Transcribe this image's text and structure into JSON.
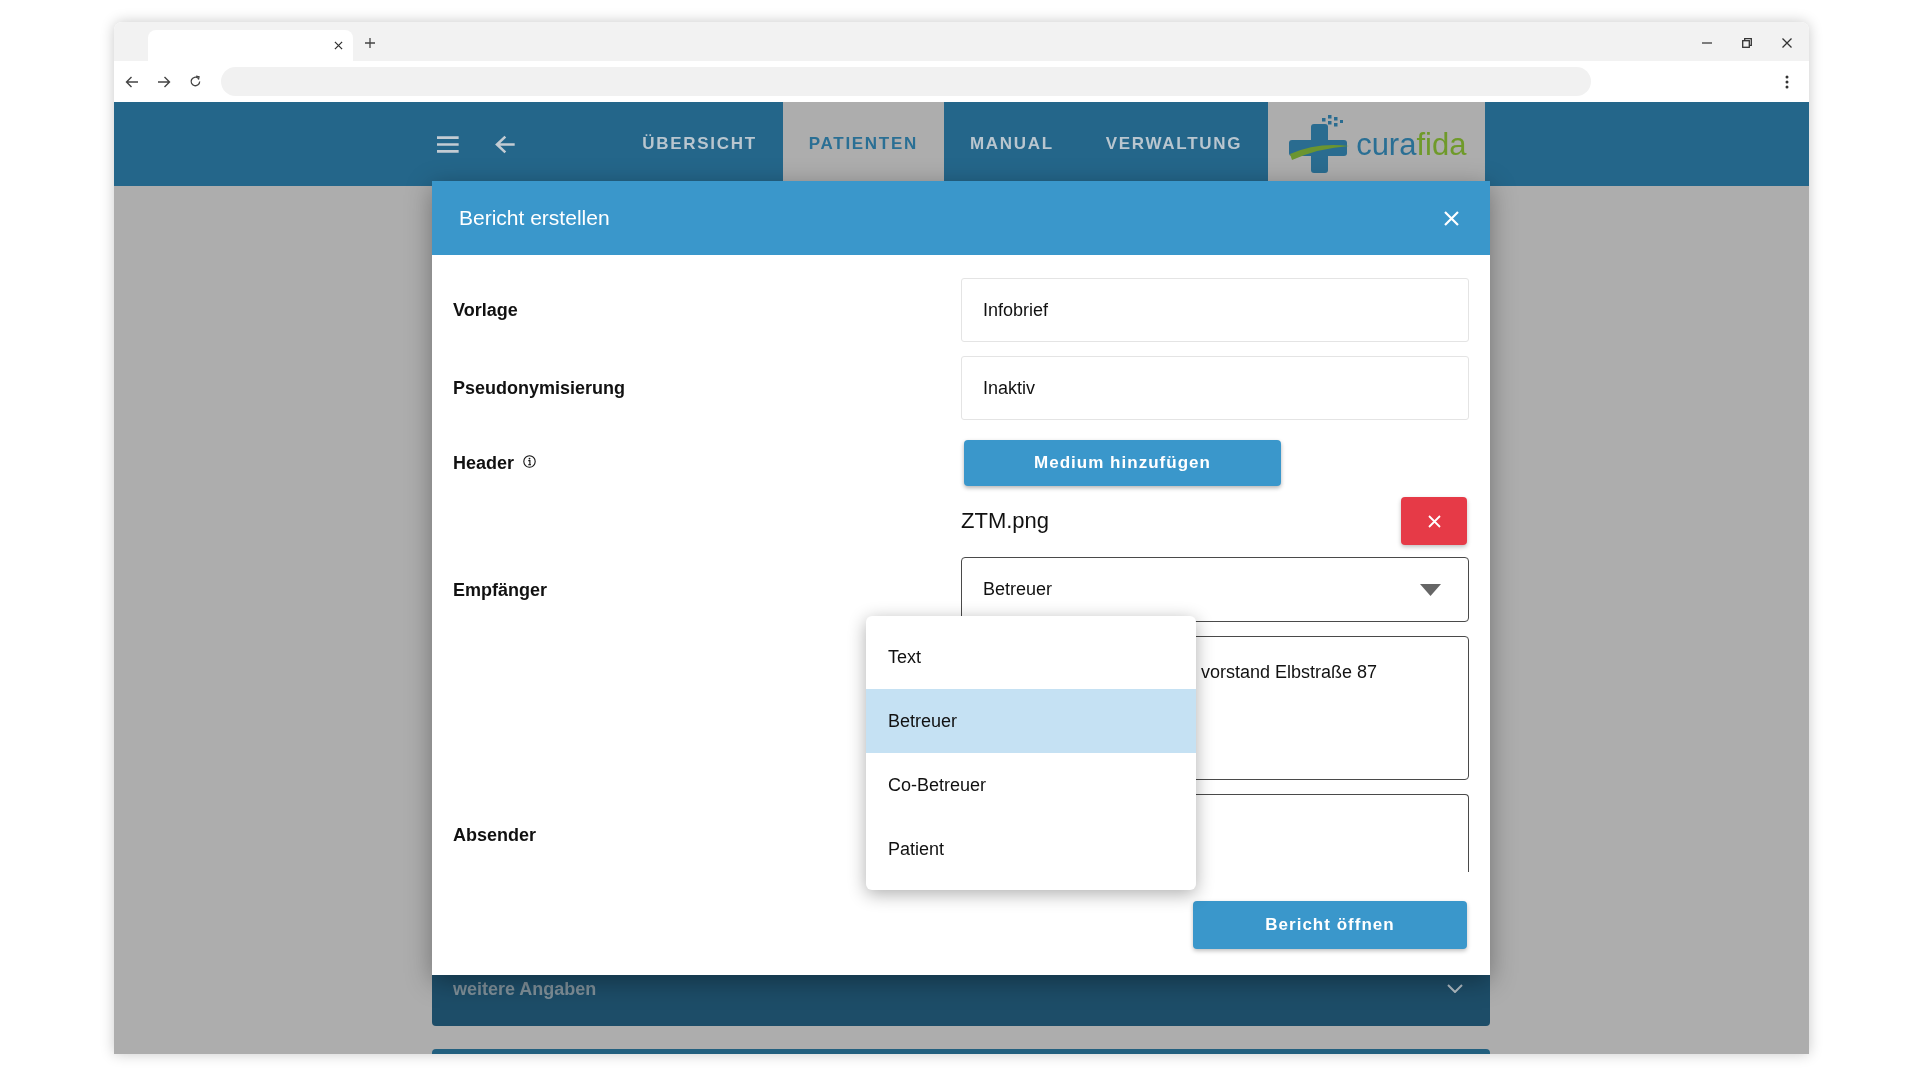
{
  "app_header": {
    "nav": [
      {
        "label": "ÜBERSICHT",
        "selected": false
      },
      {
        "label": "PATIENTEN",
        "selected": true
      },
      {
        "label": "MANUAL",
        "selected": false
      },
      {
        "label": "VERWALTUNG",
        "selected": false
      }
    ],
    "logo": {
      "wordmark_parts": [
        "cura",
        "fida"
      ]
    }
  },
  "dialog": {
    "title": "Bericht erstellen",
    "rows": [
      {
        "kind": "input",
        "label": "Vorlage",
        "value": "Infobrief"
      },
      {
        "kind": "input",
        "label": "Pseudonymisierung",
        "value": "Inaktiv"
      },
      {
        "kind": "media",
        "label": "Header",
        "info": true,
        "button": "Medium hinzufügen"
      },
      {
        "kind": "file",
        "file": "ZTM.png"
      },
      {
        "kind": "select",
        "label": "Empfänger",
        "value": "Betreuer",
        "expanded": true,
        "options": [
          {
            "label": "Text",
            "selected": false
          },
          {
            "label": "Betreuer",
            "selected": true
          },
          {
            "label": "Co-Betreuer",
            "selected": false
          },
          {
            "label": "Patient",
            "selected": false
          }
        ]
      },
      {
        "kind": "textarea",
        "value": "vorstand Elbstraße 87"
      },
      {
        "kind": "textarea",
        "label": "Absender"
      }
    ],
    "submit": "Bericht öffnen"
  },
  "background_panel": {
    "title": "weitere Angaben",
    "expanded": false
  }
}
